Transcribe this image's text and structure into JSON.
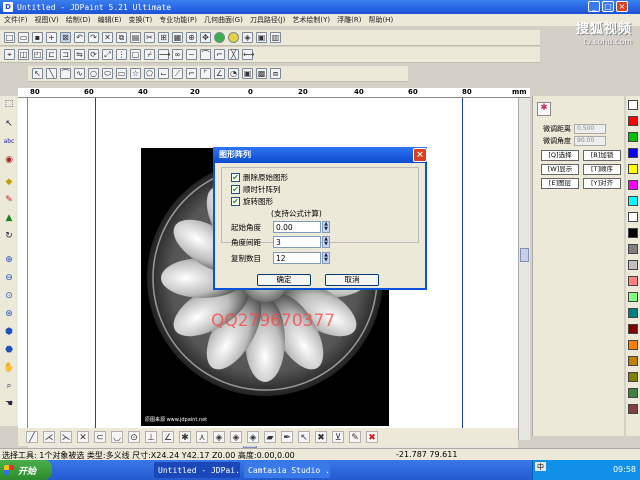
{
  "window": {
    "title": "Untitled - JDPaint 5.21 Ultimate"
  },
  "menu": [
    "文件(F)",
    "视图(V)",
    "绘制(D)",
    "编辑(E)",
    "变换(T)",
    "专业功能(P)",
    "几何曲面(G)",
    "刀具路径(J)",
    "艺术绘制(Y)",
    "浮雕(R)",
    "帮助(H)"
  ],
  "logo": {
    "line1": "搜狐视频",
    "line2": "tv.sohu.com"
  },
  "ruler": {
    "labels": [
      "80",
      "60",
      "40",
      "20",
      "0",
      "20",
      "40",
      "60",
      "80",
      "mm"
    ]
  },
  "right_panel": {
    "fine_distance_label": "微调距离",
    "fine_distance_value": "0.500",
    "fine_angle_label": "微调角度",
    "fine_angle_value": "90.00",
    "buttons": [
      "[Q]选择",
      "[B]加锁",
      "[W]显示",
      "[T]顺序",
      "[E]图层",
      "[Y]对齐"
    ]
  },
  "palette": [
    "#ffffff",
    "#ff0000",
    "#00c000",
    "#0000ff",
    "#ffff00",
    "#ff00ff",
    "#00ffff",
    "#ffffff",
    "#000000",
    "#808080",
    "#c0c0c0",
    "#ff8080",
    "#80ff80",
    "#008080",
    "#800000",
    "#ff8000",
    "#c08000",
    "#808000",
    "#408040",
    "#804040"
  ],
  "dialog": {
    "title": "图形阵列",
    "options": [
      {
        "label": "删除原始图形",
        "checked": true
      },
      {
        "label": "顺时针阵列",
        "checked": true
      },
      {
        "label": "旋转图形",
        "checked": true
      }
    ],
    "note": "(支持公式计算)",
    "fields": [
      {
        "label": "起始角度",
        "value": "0.00"
      },
      {
        "label": "角度间距",
        "value": "3"
      },
      {
        "label": "复制数目",
        "value": "12"
      }
    ],
    "ok": "确定",
    "cancel": "取消"
  },
  "watermark": "QQ279670377",
  "photo_caption_left": "原图来源 www.jdpaint.net",
  "status": {
    "left": "选择工具: 1个对象被选 类型:多义线 尺寸:X24.24 Y42.17 Z0.00 高度:0.00,0.00",
    "coords": "-21.787  79.611"
  },
  "taskbar": {
    "start": "开始",
    "tasks": [
      "Untitled - JDPai...",
      "Camtasia Studio ..."
    ],
    "ime": "中",
    "clock": "09:58"
  }
}
